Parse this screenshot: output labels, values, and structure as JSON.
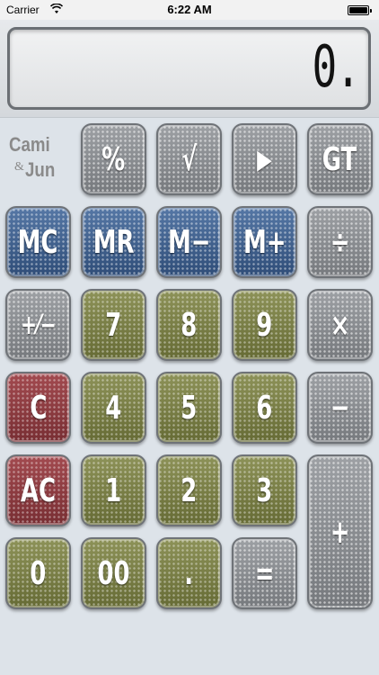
{
  "status_bar": {
    "carrier": "Carrier",
    "time": "6:22 AM"
  },
  "display": {
    "value": "0."
  },
  "logo": {
    "line1": "Cami",
    "ampersand": "&",
    "line2": "Jun"
  },
  "keys": {
    "percent": "%",
    "sqrt": "√",
    "play": "▶",
    "gt": "GT",
    "mc": "MC",
    "mr": "MR",
    "m_minus": "M−",
    "m_plus": "M+",
    "divide": "÷",
    "plus_minus": "+⁄−",
    "seven": "7",
    "eight": "8",
    "nine": "9",
    "multiply": "×",
    "clear": "C",
    "four": "4",
    "five": "5",
    "six": "6",
    "minus": "−",
    "all_clear": "AC",
    "one": "1",
    "two": "2",
    "three": "3",
    "plus": "+",
    "zero": "0",
    "double_zero": "00",
    "decimal": ".",
    "equals": "="
  },
  "colors": {
    "gray": "#8c8f93",
    "blue": "#3e6190",
    "olive": "#7a7f45",
    "red": "#8e3b3f",
    "background": "#dde3e9"
  }
}
